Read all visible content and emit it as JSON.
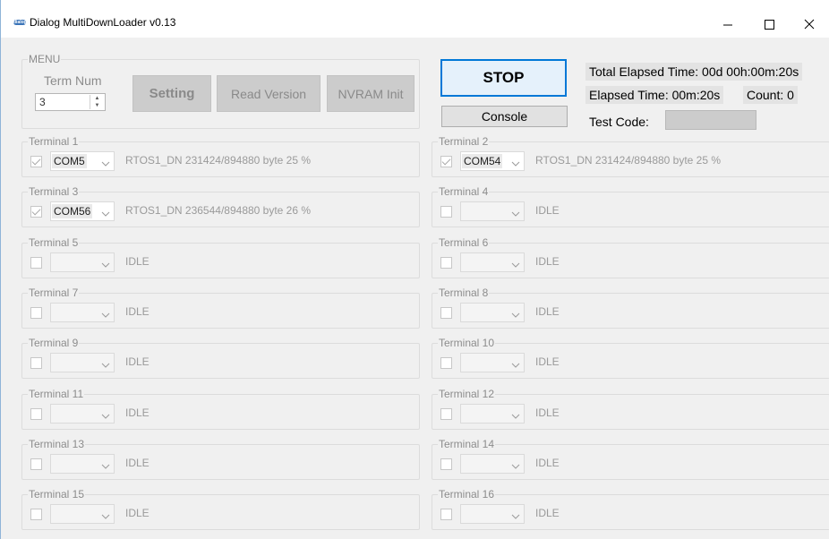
{
  "window": {
    "title": "Dialog MultiDownLoader v0.13",
    "logo_text": "dialog"
  },
  "menu": {
    "legend": "MENU",
    "term_num_label": "Term Num",
    "term_num_value": "3",
    "setting_label": "Setting",
    "read_version_label": "Read Version",
    "nvram_init_label": "NVRAM Init"
  },
  "controls": {
    "stop_label": "STOP",
    "console_label": "Console",
    "total_elapsed": "Total Elapsed Time: 00d 00h:00m:20s",
    "elapsed": "Elapsed Time: 00m:20s",
    "count": "Count: 0",
    "test_code_label": "Test Code:",
    "test_code_value": ""
  },
  "terminals": [
    {
      "label": "Terminal 1",
      "checked": true,
      "port": "COM5",
      "status": "RTOS1_DN  231424/894880 byte  25 %"
    },
    {
      "label": "Terminal 2",
      "checked": true,
      "port": "COM54",
      "status": "RTOS1_DN  231424/894880 byte  25 %"
    },
    {
      "label": "Terminal 3",
      "checked": true,
      "port": "COM56",
      "status": "RTOS1_DN  236544/894880 byte  26 %"
    },
    {
      "label": "Terminal 4",
      "checked": false,
      "port": "",
      "status": "IDLE"
    },
    {
      "label": "Terminal 5",
      "checked": false,
      "port": "",
      "status": "IDLE"
    },
    {
      "label": "Terminal 6",
      "checked": false,
      "port": "",
      "status": "IDLE"
    },
    {
      "label": "Terminal 7",
      "checked": false,
      "port": "",
      "status": "IDLE"
    },
    {
      "label": "Terminal 8",
      "checked": false,
      "port": "",
      "status": "IDLE"
    },
    {
      "label": "Terminal 9",
      "checked": false,
      "port": "",
      "status": "IDLE"
    },
    {
      "label": "Terminal 10",
      "checked": false,
      "port": "",
      "status": "IDLE"
    },
    {
      "label": "Terminal 11",
      "checked": false,
      "port": "",
      "status": "IDLE"
    },
    {
      "label": "Terminal 12",
      "checked": false,
      "port": "",
      "status": "IDLE"
    },
    {
      "label": "Terminal 13",
      "checked": false,
      "port": "",
      "status": "IDLE"
    },
    {
      "label": "Terminal 14",
      "checked": false,
      "port": "",
      "status": "IDLE"
    },
    {
      "label": "Terminal 15",
      "checked": false,
      "port": "",
      "status": "IDLE"
    },
    {
      "label": "Terminal 16",
      "checked": false,
      "port": "",
      "status": "IDLE"
    }
  ],
  "icons": {
    "minimize": "minimize-icon",
    "maximize": "maximize-icon",
    "close": "close-icon",
    "dropdown": "chevron-down-icon"
  }
}
